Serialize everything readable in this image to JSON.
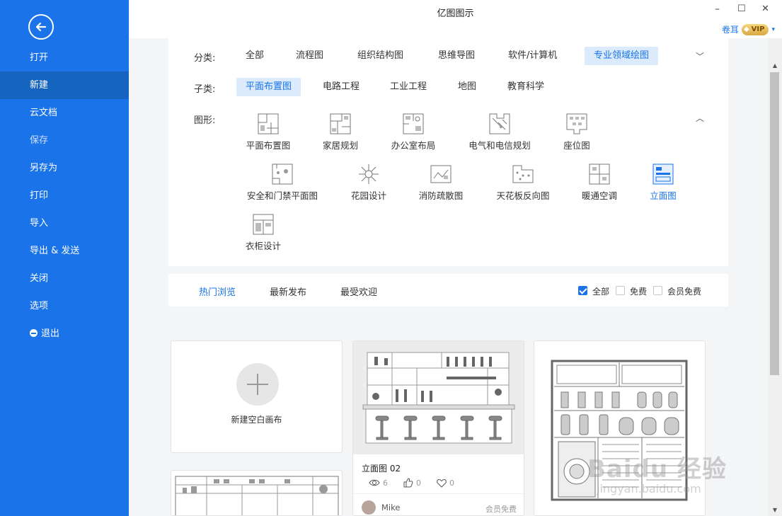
{
  "app": {
    "title": "亿图图示"
  },
  "window": {
    "minimize": "–",
    "maximize": "☐",
    "close": "✕"
  },
  "user": {
    "name": "卷耳",
    "vip": "VIP",
    "caret": "▾"
  },
  "sidebar": {
    "items": [
      {
        "label": "打开"
      },
      {
        "label": "新建"
      },
      {
        "label": "云文档"
      },
      {
        "label": "保存"
      },
      {
        "label": "另存为"
      },
      {
        "label": "打印"
      },
      {
        "label": "导入"
      },
      {
        "label": "导出 & 发送"
      },
      {
        "label": "关闭"
      },
      {
        "label": "选项"
      },
      {
        "label": "退出"
      }
    ]
  },
  "category": {
    "label": "分类:",
    "items": [
      "全部",
      "流程图",
      "组织结构图",
      "思维导图",
      "软件/计算机",
      "专业领域绘图"
    ],
    "selected": "专业领域绘图",
    "toggle": "﹀"
  },
  "subcategory": {
    "label": "子类:",
    "items": [
      "平面布置图",
      "电路工程",
      "工业工程",
      "地图",
      "教育科学"
    ],
    "selected": "平面布置图"
  },
  "shapes": {
    "label": "图形:",
    "toggle": "︿",
    "items": [
      {
        "label": "平面布置图",
        "icon": "floor-plan-icon"
      },
      {
        "label": "家居规划",
        "icon": "home-plan-icon"
      },
      {
        "label": "办公室布局",
        "icon": "office-layout-icon"
      },
      {
        "label": "电气和电信规划",
        "icon": "electrical-plan-icon"
      },
      {
        "label": "座位图",
        "icon": "seating-chart-icon"
      },
      {
        "label": "安全和门禁平面图",
        "icon": "security-plan-icon"
      },
      {
        "label": "花园设计",
        "icon": "garden-design-icon"
      },
      {
        "label": "消防疏散图",
        "icon": "fire-evacuation-icon"
      },
      {
        "label": "天花板反向图",
        "icon": "ceiling-plan-icon"
      },
      {
        "label": "暖通空调",
        "icon": "hvac-icon"
      },
      {
        "label": "立面图",
        "icon": "elevation-icon"
      },
      {
        "label": "衣柜设计",
        "icon": "wardrobe-design-icon"
      }
    ],
    "selected": "立面图"
  },
  "filter": {
    "tabs": [
      "热门浏览",
      "最新发布",
      "最受欢迎"
    ],
    "selected_tab": "热门浏览",
    "checks": [
      {
        "label": "全部",
        "checked": true
      },
      {
        "label": "免费",
        "checked": false
      },
      {
        "label": "会员免费",
        "checked": false
      }
    ]
  },
  "cards": {
    "new_canvas_label": "新建空白画布",
    "template": {
      "title": "立面图 02",
      "views": "6",
      "likes": "0",
      "favorites": "0",
      "author": "Mike",
      "price": "会员免费"
    }
  },
  "watermark": {
    "main": "Baidu 经验",
    "sub": "jingyan.baidu.com"
  },
  "colors": {
    "accent": "#1a73e8",
    "sidebar": "#1a73e8",
    "sidebar_active": "#1565c0",
    "chip_selected_bg": "#dcebfc"
  }
}
